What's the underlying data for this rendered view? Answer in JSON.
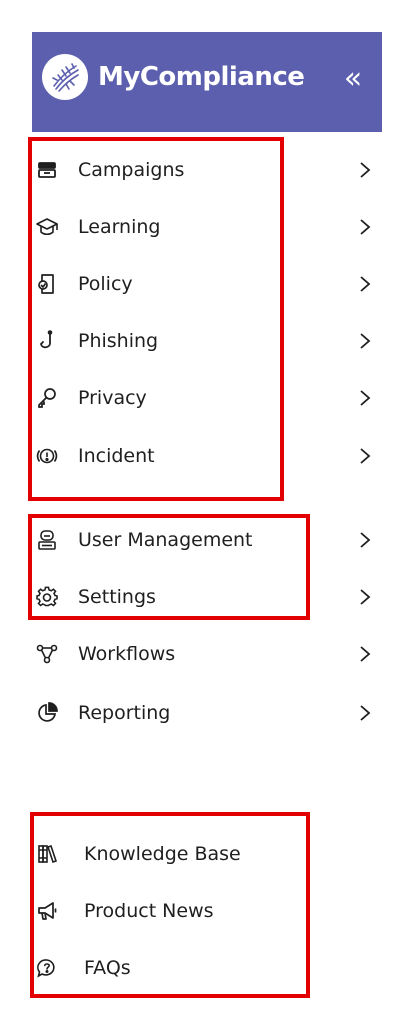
{
  "brand": {
    "title": "MyCompliance"
  },
  "header_icons": {
    "collapse": "«"
  },
  "main_menu": [
    {
      "label": "Campaigns",
      "icon": "campaigns-icon"
    },
    {
      "label": "Learning",
      "icon": "graduation-cap-icon"
    },
    {
      "label": "Policy",
      "icon": "policy-document-icon"
    },
    {
      "label": "Phishing",
      "icon": "fishhook-icon"
    },
    {
      "label": "Privacy",
      "icon": "key-icon"
    },
    {
      "label": "Incident",
      "icon": "alert-icon"
    }
  ],
  "admin_menu": [
    {
      "label": "User Management",
      "icon": "user-management-icon"
    },
    {
      "label": "Settings",
      "icon": "gear-icon"
    },
    {
      "label": "Workflows",
      "icon": "workflow-icon"
    },
    {
      "label": "Reporting",
      "icon": "pie-chart-icon"
    }
  ],
  "footer_menu": [
    {
      "label": "Knowledge Base",
      "icon": "books-icon"
    },
    {
      "label": "Product News",
      "icon": "megaphone-icon"
    },
    {
      "label": "FAQs",
      "icon": "question-bubble-icon"
    }
  ],
  "colors": {
    "header_bg": "#5b5fae",
    "highlight": "#e20000",
    "text": "#1f1f1f"
  }
}
